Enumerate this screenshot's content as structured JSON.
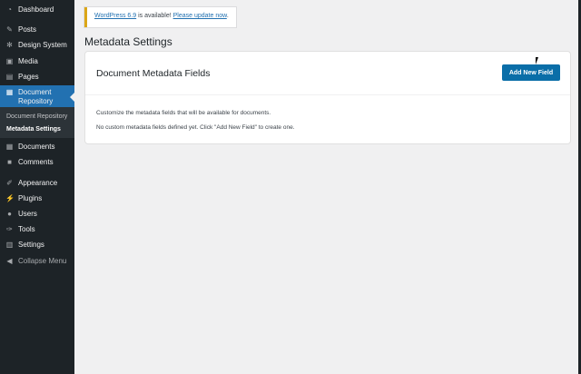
{
  "sidebar": {
    "items": [
      {
        "label": "Dashboard",
        "icon": "dashboard-icon",
        "glyph": "◔"
      },
      {
        "label": "Posts",
        "icon": "pin-icon",
        "glyph": "✎"
      },
      {
        "label": "Design System",
        "icon": "gear-icon",
        "glyph": "✻"
      },
      {
        "label": "Media",
        "icon": "media-icon",
        "glyph": "▣"
      },
      {
        "label": "Pages",
        "icon": "pages-icon",
        "glyph": "▤"
      },
      {
        "label": "Document Repository",
        "icon": "document-icon",
        "glyph": "▦"
      },
      {
        "label": "Documents",
        "icon": "document-icon",
        "glyph": "▦"
      },
      {
        "label": "Comments",
        "icon": "comment-icon",
        "glyph": "■"
      },
      {
        "label": "Appearance",
        "icon": "brush-icon",
        "glyph": "✐"
      },
      {
        "label": "Plugins",
        "icon": "plugin-icon",
        "glyph": "⚡"
      },
      {
        "label": "Users",
        "icon": "user-icon",
        "glyph": "●"
      },
      {
        "label": "Tools",
        "icon": "wrench-icon",
        "glyph": "✑"
      },
      {
        "label": "Settings",
        "icon": "settings-icon",
        "glyph": "▥"
      },
      {
        "label": "Collapse Menu",
        "icon": "collapse-icon",
        "glyph": "◀"
      }
    ],
    "submenu": [
      "Document Repository",
      "Metadata Settings"
    ]
  },
  "notice": {
    "link1": "WordPress 6.9",
    "text": " is available! ",
    "link2": "Please update now",
    "end": "."
  },
  "page_title": "Metadata Settings",
  "card": {
    "title": "Document Metadata Fields",
    "button": "Add New Field",
    "description": "Customize the metadata fields that will be available for documents.",
    "empty": "No custom metadata fields defined yet. Click \"Add New Field\" to create one."
  },
  "colors": {
    "accent": "#2271b1",
    "sidebar": "#1d2327",
    "button": "#0a6ea8"
  }
}
